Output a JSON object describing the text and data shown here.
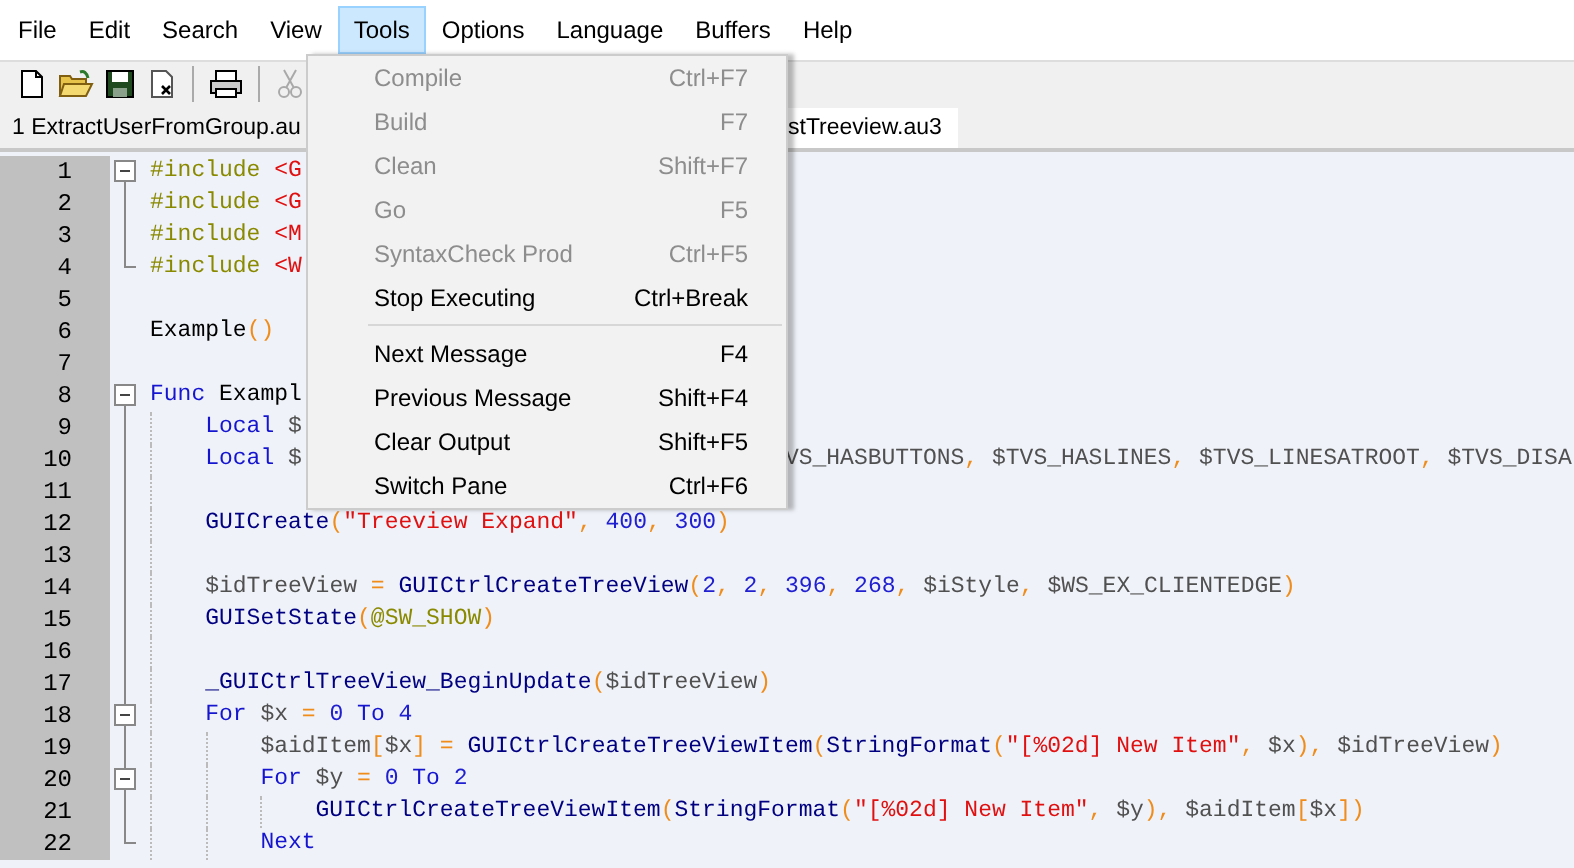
{
  "menu_bar": [
    {
      "label": "File",
      "selected": false
    },
    {
      "label": "Edit",
      "selected": false
    },
    {
      "label": "Search",
      "selected": false
    },
    {
      "label": "View",
      "selected": false
    },
    {
      "label": "Tools",
      "selected": true
    },
    {
      "label": "Options",
      "selected": false
    },
    {
      "label": "Language",
      "selected": false
    },
    {
      "label": "Buffers",
      "selected": false
    },
    {
      "label": "Help",
      "selected": false
    }
  ],
  "toolbar": [
    {
      "kind": "new"
    },
    {
      "kind": "open"
    },
    {
      "kind": "save"
    },
    {
      "kind": "close"
    },
    {
      "kind": "separator"
    },
    {
      "kind": "print"
    },
    {
      "kind": "separator"
    },
    {
      "kind": "cut",
      "disabled": true
    }
  ],
  "tabs": [
    {
      "label": "1 ExtractUserFromGroup.au",
      "selected": false
    },
    {
      "label": "stTreeview.au3",
      "selected": true
    }
  ],
  "tools_menu": [
    {
      "label": "Compile",
      "shortcut": "Ctrl+F7",
      "disabled": true,
      "separator_after": false
    },
    {
      "label": "Build",
      "shortcut": "F7",
      "disabled": true,
      "separator_after": false
    },
    {
      "label": "Clean",
      "shortcut": "Shift+F7",
      "disabled": true,
      "separator_after": false
    },
    {
      "label": "Go",
      "shortcut": "F5",
      "disabled": true,
      "separator_after": false
    },
    {
      "label": "SyntaxCheck Prod",
      "shortcut": "Ctrl+F5",
      "disabled": true,
      "separator_after": false
    },
    {
      "label": "Stop Executing",
      "shortcut": "Ctrl+Break",
      "disabled": false,
      "separator_after": true
    },
    {
      "label": "Next Message",
      "shortcut": "F4",
      "disabled": false,
      "separator_after": false
    },
    {
      "label": "Previous Message",
      "shortcut": "Shift+F4",
      "disabled": false,
      "separator_after": false
    },
    {
      "label": "Clear Output",
      "shortcut": "Shift+F5",
      "disabled": false,
      "separator_after": false
    },
    {
      "label": "Switch Pane",
      "shortcut": "Ctrl+F6",
      "disabled": false,
      "separator_after": false
    }
  ],
  "editor": {
    "lines": [
      {
        "number": "1",
        "kind": "fold_start",
        "segments": [
          {
            "kind": "directive",
            "text": "#include "
          },
          {
            "kind": "string",
            "text": "<G"
          }
        ]
      },
      {
        "number": "2",
        "kind": "fold_body",
        "segments": [
          {
            "kind": "directive",
            "text": "#include "
          },
          {
            "kind": "string",
            "text": "<G"
          }
        ]
      },
      {
        "number": "3",
        "kind": "fold_body",
        "segments": [
          {
            "kind": "directive",
            "text": "#include "
          },
          {
            "kind": "string",
            "text": "<M"
          }
        ]
      },
      {
        "number": "4",
        "kind": "fold_end",
        "segments": [
          {
            "kind": "directive",
            "text": "#include "
          },
          {
            "kind": "string",
            "text": "<W"
          }
        ]
      },
      {
        "number": "5",
        "kind": "plain"
      },
      {
        "number": "6",
        "kind": "plain",
        "segments": [
          {
            "kind": "plain",
            "text": "Example"
          },
          {
            "kind": "operator",
            "text": "()"
          }
        ]
      },
      {
        "number": "7",
        "kind": "plain"
      },
      {
        "number": "8",
        "kind": "fold_start",
        "segments": [
          {
            "kind": "keyword",
            "text": "Func "
          },
          {
            "kind": "plain",
            "text": "Exampl"
          }
        ],
        "children": [
          {
            "number": "9",
            "kind": "fold_body",
            "segments": [
              {
                "kind": "keyword",
                "text": "Local "
              },
              {
                "kind": "variable",
                "text": "$"
              }
            ]
          },
          {
            "number": "10",
            "kind": "fold_body",
            "segments": [
              {
                "kind": "keyword",
                "text": "Local "
              },
              {
                "kind": "variable",
                "text": "$"
              }
            ],
            "right_segments": [
              {
                "kind": "variable",
                "text": "VS_HASBUTTONS"
              },
              {
                "kind": "operator",
                "text": ", "
              },
              {
                "kind": "variable",
                "text": "$TVS_HASLINES"
              },
              {
                "kind": "operator",
                "text": ", "
              },
              {
                "kind": "variable",
                "text": "$TVS_LINESATROOT"
              },
              {
                "kind": "operator",
                "text": ", "
              },
              {
                "kind": "variable",
                "text": "$TVS_DISA"
              }
            ]
          },
          {
            "number": "11",
            "kind": "fold_body"
          },
          {
            "number": "12",
            "kind": "fold_body",
            "segments": [
              {
                "kind": "function",
                "text": "GUICreate"
              },
              {
                "kind": "operator",
                "text": "("
              },
              {
                "kind": "string",
                "text": "\"Treeview Expand\""
              },
              {
                "kind": "operator",
                "text": ", "
              },
              {
                "kind": "number",
                "text": "400"
              },
              {
                "kind": "operator",
                "text": ", "
              },
              {
                "kind": "number",
                "text": "300"
              },
              {
                "kind": "operator",
                "text": ")"
              }
            ]
          },
          {
            "number": "13",
            "kind": "fold_body"
          },
          {
            "number": "14",
            "kind": "fold_body",
            "segments": [
              {
                "kind": "variable",
                "text": "$idTreeView "
              },
              {
                "kind": "operator",
                "text": "= "
              },
              {
                "kind": "function",
                "text": "GUICtrlCreateTreeView"
              },
              {
                "kind": "operator",
                "text": "("
              },
              {
                "kind": "number",
                "text": "2"
              },
              {
                "kind": "operator",
                "text": ", "
              },
              {
                "kind": "number",
                "text": "2"
              },
              {
                "kind": "operator",
                "text": ", "
              },
              {
                "kind": "number",
                "text": "396"
              },
              {
                "kind": "operator",
                "text": ", "
              },
              {
                "kind": "number",
                "text": "268"
              },
              {
                "kind": "operator",
                "text": ", "
              },
              {
                "kind": "variable",
                "text": "$iStyle"
              },
              {
                "kind": "operator",
                "text": ", "
              },
              {
                "kind": "variable",
                "text": "$WS_EX_CLIENTEDGE"
              },
              {
                "kind": "operator",
                "text": ")"
              }
            ]
          },
          {
            "number": "15",
            "kind": "fold_body",
            "segments": [
              {
                "kind": "function",
                "text": "GUISetState"
              },
              {
                "kind": "operator",
                "text": "("
              },
              {
                "kind": "macro",
                "text": "@SW_SHOW"
              },
              {
                "kind": "operator",
                "text": ")"
              }
            ]
          },
          {
            "number": "16",
            "kind": "fold_body"
          },
          {
            "number": "17",
            "kind": "fold_body",
            "segments": [
              {
                "kind": "function",
                "text": "_GUICtrlTreeView_BeginUpdate"
              },
              {
                "kind": "operator",
                "text": "("
              },
              {
                "kind": "variable",
                "text": "$idTreeView"
              },
              {
                "kind": "operator",
                "text": ")"
              }
            ]
          },
          {
            "number": "18",
            "kind": "fold_start",
            "segments": [
              {
                "kind": "keyword",
                "text": "For "
              },
              {
                "kind": "variable",
                "text": "$x "
              },
              {
                "kind": "operator",
                "text": "= "
              },
              {
                "kind": "number",
                "text": "0 "
              },
              {
                "kind": "keyword",
                "text": "To "
              },
              {
                "kind": "number",
                "text": "4"
              }
            ],
            "children": [
              {
                "number": "19",
                "kind": "fold_body",
                "segments": [
                  {
                    "kind": "variable",
                    "text": "$aidItem"
                  },
                  {
                    "kind": "operator",
                    "text": "["
                  },
                  {
                    "kind": "variable",
                    "text": "$x"
                  },
                  {
                    "kind": "operator",
                    "text": "] = "
                  },
                  {
                    "kind": "function",
                    "text": "GUICtrlCreateTreeViewItem"
                  },
                  {
                    "kind": "operator",
                    "text": "("
                  },
                  {
                    "kind": "function",
                    "text": "StringFormat"
                  },
                  {
                    "kind": "operator",
                    "text": "("
                  },
                  {
                    "kind": "string",
                    "text": "\"[%02d] New Item\""
                  },
                  {
                    "kind": "operator",
                    "text": ", "
                  },
                  {
                    "kind": "variable",
                    "text": "$x"
                  },
                  {
                    "kind": "operator",
                    "text": "), "
                  },
                  {
                    "kind": "variable",
                    "text": "$idTreeView"
                  },
                  {
                    "kind": "operator",
                    "text": ")"
                  }
                ]
              },
              {
                "number": "20",
                "kind": "fold_start",
                "segments": [
                  {
                    "kind": "keyword",
                    "text": "For "
                  },
                  {
                    "kind": "variable",
                    "text": "$y "
                  },
                  {
                    "kind": "operator",
                    "text": "= "
                  },
                  {
                    "kind": "number",
                    "text": "0 "
                  },
                  {
                    "kind": "keyword",
                    "text": "To "
                  },
                  {
                    "kind": "number",
                    "text": "2"
                  }
                ],
                "children": [
                  {
                    "number": "21",
                    "kind": "fold_body",
                    "segments": [
                      {
                        "kind": "function",
                        "text": "GUICtrlCreateTreeViewItem"
                      },
                      {
                        "kind": "operator",
                        "text": "("
                      },
                      {
                        "kind": "function",
                        "text": "StringFormat"
                      },
                      {
                        "kind": "operator",
                        "text": "("
                      },
                      {
                        "kind": "string",
                        "text": "\"[%02d] New Item\""
                      },
                      {
                        "kind": "operator",
                        "text": ", "
                      },
                      {
                        "kind": "variable",
                        "text": "$y"
                      },
                      {
                        "kind": "operator",
                        "text": "), "
                      },
                      {
                        "kind": "variable",
                        "text": "$aidItem"
                      },
                      {
                        "kind": "operator",
                        "text": "["
                      },
                      {
                        "kind": "variable",
                        "text": "$x"
                      },
                      {
                        "kind": "operator",
                        "text": "])"
                      }
                    ]
                  }
                ]
              },
              {
                "number": "22",
                "kind": "fold_end",
                "segments": [
                  {
                    "kind": "keyword",
                    "text": "Next"
                  }
                ]
              }
            ]
          }
        ]
      }
    ]
  }
}
